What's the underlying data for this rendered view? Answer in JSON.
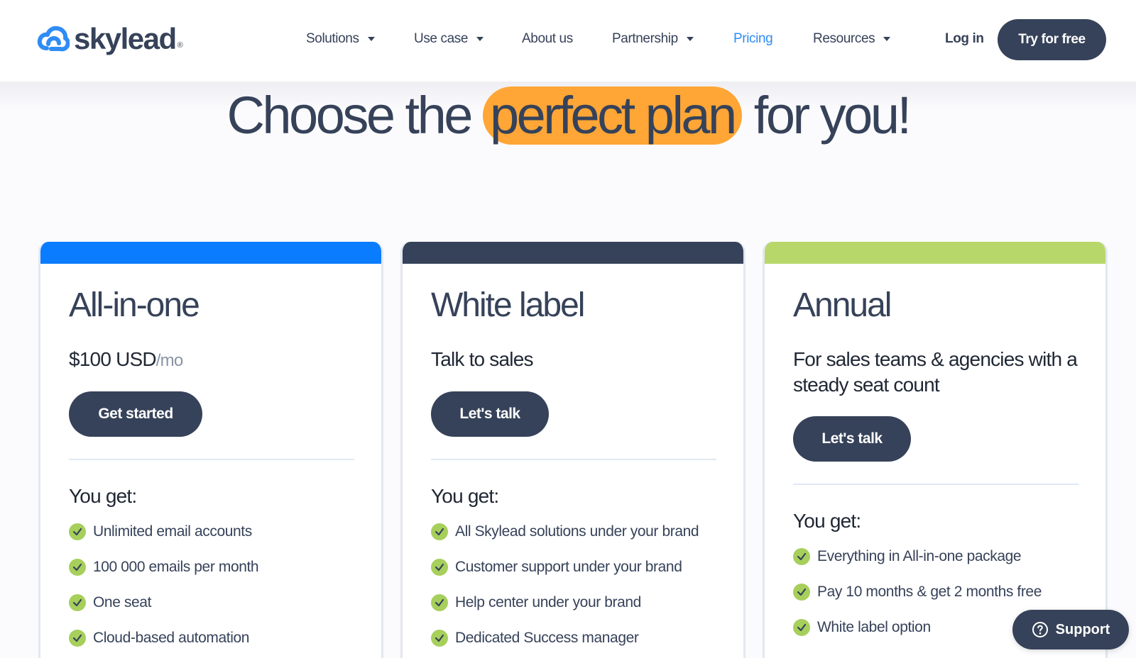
{
  "brand": {
    "name": "skylead",
    "reg": "®",
    "accent": "#2f8cf5",
    "dark": "#364259",
    "highlight": "#ffa636",
    "green": "#a6cf5b"
  },
  "nav": {
    "items": [
      {
        "label": "Solutions",
        "dropdown": true
      },
      {
        "label": "Use case",
        "dropdown": true
      },
      {
        "label": "About us",
        "dropdown": false
      },
      {
        "label": "Partnership",
        "dropdown": true
      },
      {
        "label": "Pricing",
        "dropdown": false,
        "active": true
      },
      {
        "label": "Resources",
        "dropdown": true
      }
    ],
    "login": "Log in",
    "cta": "Try for free"
  },
  "hero": {
    "pre": "Choose the",
    "highlight": "perfect plan",
    "post": "for you!"
  },
  "plans": [
    {
      "title": "All-in-one",
      "price": "$100 USD",
      "price_unit": "/mo",
      "cta": "Get started",
      "you_get": "You get:",
      "features": [
        "Unlimited email accounts",
        "100 000 emails per month",
        "One seat",
        "Cloud-based automation"
      ],
      "top_color": "#0a7cff"
    },
    {
      "title": "White label",
      "subtitle": "Talk to sales",
      "cta": "Let's talk",
      "you_get": "You get:",
      "features": [
        "All Skylead solutions under your brand",
        "Customer support under your brand",
        "Help center under your brand",
        "Dedicated Success manager"
      ],
      "top_color": "#364259"
    },
    {
      "title": "Annual",
      "subtitle": "For sales teams & agencies with a steady seat count",
      "cta": "Let's talk",
      "you_get": "You get:",
      "features": [
        "Everything in All-in-one package",
        "Pay 10 months & get 2 months free",
        "White label option"
      ],
      "top_color": "#b8d76a"
    }
  ],
  "support": {
    "label": "Support",
    "icon": "question-circle-icon"
  }
}
